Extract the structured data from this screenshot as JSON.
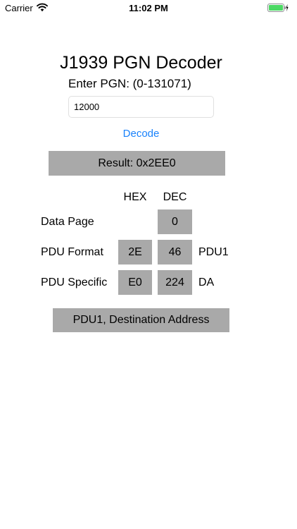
{
  "status_bar": {
    "carrier": "Carrier",
    "time": "11:02 PM"
  },
  "title": "J1939 PGN Decoder",
  "prompt": "Enter PGN: (0-131071)",
  "pgn_input": {
    "value": "12000"
  },
  "decode_label": "Decode",
  "result_label": "Result: 0x2EE0",
  "headers": {
    "hex": "HEX",
    "dec": "DEC"
  },
  "rows": {
    "data_page": {
      "label": "Data Page",
      "hex": "",
      "dec": "0",
      "suffix": ""
    },
    "pdu_format": {
      "label": "PDU Format",
      "hex": "2E",
      "dec": "46",
      "suffix": "PDU1"
    },
    "pdu_specific": {
      "label": "PDU Specific",
      "hex": "E0",
      "dec": "224",
      "suffix": "DA"
    }
  },
  "pdu_type_label": "PDU1, Destination Address",
  "colors": {
    "accent": "#1a82fb",
    "cell_bg": "#a9a9a9",
    "battery": "#4cd964"
  }
}
